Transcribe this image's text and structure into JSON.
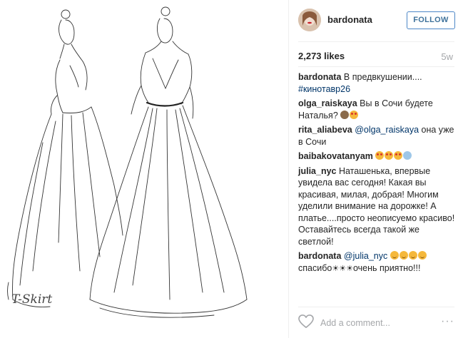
{
  "post": {
    "author": "bardonata",
    "follow_label": "FOLLOW",
    "likes": "2,273 likes",
    "age": "5w",
    "image_signature": "T-Skirt"
  },
  "comments": [
    {
      "user": "bardonata",
      "parts": [
        {
          "t": "text",
          "v": " В предвкушении.... "
        },
        {
          "t": "link",
          "v": "#кинотавр26"
        }
      ]
    },
    {
      "user": "olga_raiskaya",
      "parts": [
        {
          "t": "text",
          "v": " Вы в Сочи будете Наталья? "
        },
        {
          "t": "emoji",
          "v": "monkey"
        },
        {
          "t": "emoji",
          "v": "hearteye"
        }
      ]
    },
    {
      "user": "rita_aliabeva",
      "parts": [
        {
          "t": "link",
          "v": " @olga_raiskaya"
        },
        {
          "t": "text",
          "v": " она уже в Сочи"
        }
      ]
    },
    {
      "user": "baibakovatanyam",
      "parts": [
        {
          "t": "text",
          "v": " "
        },
        {
          "t": "emoji",
          "v": "hearteye"
        },
        {
          "t": "emoji",
          "v": "hearteye"
        },
        {
          "t": "emoji",
          "v": "hearteye"
        },
        {
          "t": "emoji",
          "v": "scream"
        }
      ]
    },
    {
      "user": "julia_nyc",
      "parts": [
        {
          "t": "text",
          "v": " Наташенька, впервые увидела вас сегодня! Какая вы красивая, милая, добрая! Многим уделили внимание на дорожке! А платье....просто неописуемо красиво! Оставайтесь всегда такой же светлой!"
        }
      ]
    },
    {
      "user": "bardonata",
      "parts": [
        {
          "t": "link",
          "v": " @julia_nyc"
        },
        {
          "t": "text",
          "v": " "
        },
        {
          "t": "emoji",
          "v": "smile"
        },
        {
          "t": "emoji",
          "v": "smile"
        },
        {
          "t": "emoji",
          "v": "smile"
        },
        {
          "t": "emoji",
          "v": "smile"
        },
        {
          "t": "text",
          "v": "спасибо"
        },
        {
          "t": "sun",
          "v": "☀"
        },
        {
          "t": "sun",
          "v": "☀"
        },
        {
          "t": "sun",
          "v": "☀"
        },
        {
          "t": "text",
          "v": "очень приятно!!!"
        }
      ]
    }
  ],
  "footer": {
    "placeholder": "Add a comment...",
    "more_label": "···"
  },
  "icons": {
    "heart": "heart-icon",
    "more": "more-options-icon"
  },
  "colors": {
    "follow_border": "#4d87c7",
    "follow_text": "#3f729b",
    "link": "#003569",
    "muted": "#a5a7aa"
  }
}
